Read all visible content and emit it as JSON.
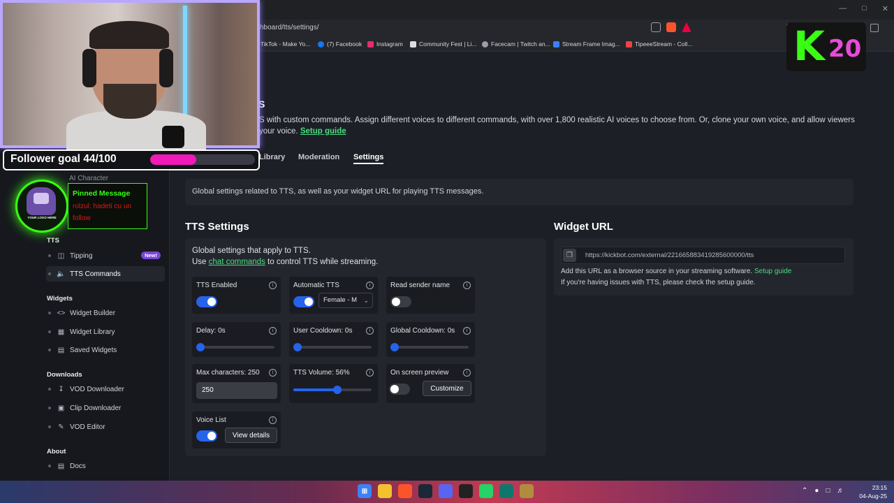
{
  "browser": {
    "url": "hboard/tts/settings/",
    "bookmarks": [
      {
        "label": ")TikTok - Make Yo...",
        "color": "#111111"
      },
      {
        "label": "(7) Facebook",
        "color": "#1877f2"
      },
      {
        "label": "Instagram",
        "color": "#e1306c"
      },
      {
        "label": "Community Fest | Li...",
        "color": "#dddddd"
      },
      {
        "label": "Facecam | Twitch an...",
        "color": "#9aa0a6"
      },
      {
        "label": "Stream Frame Imag...",
        "color": "#3b82f6"
      },
      {
        "label": "TipeeeStream - Coll...",
        "color": "#ef4444"
      }
    ]
  },
  "sidebar": {
    "ai_character": "AI Character",
    "tts_section": "TTS",
    "tts_items": [
      {
        "label": "Tipping",
        "badge": "New!"
      },
      {
        "label": "TTS Commands"
      }
    ],
    "widgets_section": "Widgets",
    "widget_items": [
      {
        "label": "Widget Builder"
      },
      {
        "label": "Widget Library"
      },
      {
        "label": "Saved Widgets"
      }
    ],
    "downloads_section": "Downloads",
    "download_items": [
      {
        "label": "VOD Downloader"
      },
      {
        "label": "Clip Downloader"
      },
      {
        "label": "VOD Editor"
      }
    ],
    "about_section": "About",
    "about_items": [
      {
        "label": "Docs"
      }
    ]
  },
  "header": {
    "title": "S",
    "desc_line1": "S with custom commands. Assign different voices to different commands, with over 1,800 realistic AI voices to choose from. Or, clone your own voice, and allow viewers",
    "desc_line2_prefix": "your voice.",
    "setup_guide": "Setup guide"
  },
  "tabs": [
    {
      "label": "Library"
    },
    {
      "label": "Moderation"
    },
    {
      "label": "Settings",
      "active": true
    }
  ],
  "info_text": "Global settings related to TTS, as well as your widget URL for playing TTS messages.",
  "tts_settings": {
    "heading": "TTS Settings",
    "desc1": "Global settings that apply to TTS.",
    "desc2_prefix": "Use",
    "desc2_link": "chat commands",
    "desc2_suffix": "to control TTS while streaming.",
    "tts_enabled": {
      "label": "TTS Enabled",
      "on": true
    },
    "automatic_tts": {
      "label": "Automatic TTS",
      "on": true,
      "voice": "Female - M"
    },
    "read_sender": {
      "label": "Read sender name",
      "on": false
    },
    "delay": {
      "label": "Delay: 0s",
      "value": 0
    },
    "user_cooldown": {
      "label": "User Cooldown: 0s",
      "value": 0
    },
    "global_cooldown": {
      "label": "Global Cooldown: 0s",
      "value": 0
    },
    "max_chars": {
      "label": "Max characters: 250",
      "value": "250"
    },
    "tts_volume": {
      "label": "TTS Volume: 56%",
      "value": 0.56
    },
    "on_screen_preview": {
      "label": "On screen preview",
      "on": false,
      "button": "Customize"
    },
    "voice_list": {
      "label": "Voice List",
      "on": true,
      "button": "View details"
    }
  },
  "widget_url": {
    "heading": "Widget URL",
    "url": "https://kickbot.com/external/221665883419285600000/tts",
    "desc1_prefix": "Add this URL as a browser source in your streaming software.",
    "desc1_link": "Setup guide",
    "desc2": "If you're having issues with TTS, please check the setup guide."
  },
  "overlay": {
    "goal_text": "Follower goal 44/100",
    "goal_progress": 0.44,
    "logo_text": "YOUR LOGO HERE",
    "pinned_title": "Pinned Message",
    "pinned_msg": "rolzul: hadeti cu un follow",
    "badge_letter": "K",
    "badge_number": "20"
  },
  "taskbar": {
    "time": "23:15",
    "date": "04-Aug-25"
  }
}
